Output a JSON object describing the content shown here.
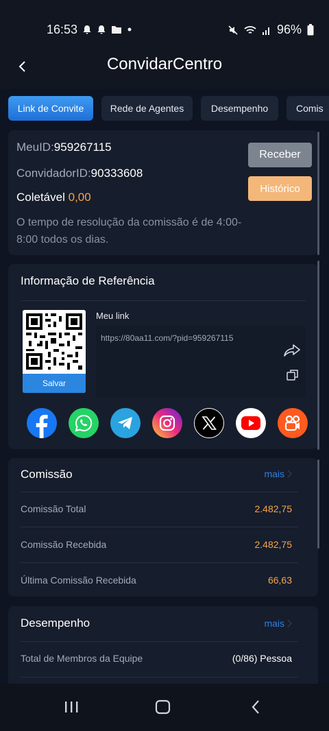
{
  "status_bar": {
    "time": "16:53",
    "battery": "96%"
  },
  "header": {
    "title": "ConvidarCentro"
  },
  "tabs": [
    {
      "label": "Link de Convite",
      "active": true
    },
    {
      "label": "Rede de Agentes",
      "active": false
    },
    {
      "label": "Desempenho",
      "active": false
    },
    {
      "label": "Comis",
      "active": false
    }
  ],
  "account": {
    "my_id_label": "MeuID:",
    "my_id": "959267115",
    "inviter_label": "ConvidadorID:",
    "inviter_id": "90333608",
    "collectable_label": "Coletável",
    "collectable_value": "0,00",
    "receive_button": "Receber",
    "history_button": "Histórico",
    "note": "O tempo de resolução da comissão é de 4:00-8:00 todos os dias."
  },
  "referral": {
    "title": "Informação de Referência",
    "save_button": "Salvar",
    "link_label": "Meu link",
    "url": "https://80aa11.com/?pid=959267115",
    "social": [
      "facebook-icon",
      "whatsapp-icon",
      "telegram-icon",
      "instagram-icon",
      "x-icon",
      "youtube-icon",
      "kwai-icon"
    ]
  },
  "commission": {
    "title": "Comissão",
    "more": "mais",
    "rows": [
      {
        "label": "Comissão Total",
        "value": "2.482,75"
      },
      {
        "label": "Comissão Recebida",
        "value": "2.482,75"
      },
      {
        "label": "Última Comissão Recebida",
        "value": "66,63"
      }
    ]
  },
  "performance": {
    "title": "Desempenho",
    "more": "mais",
    "rows": [
      {
        "label": "Total de Membros da Equipe",
        "value": "(0/86) Pessoa"
      }
    ]
  },
  "colors": {
    "background": "#0e1421",
    "card": "#161d2c",
    "accent_blue": "#2b86e0",
    "accent_orange": "#f7a44a",
    "history_button": "#f4b77a",
    "receive_button": "#7c8490"
  }
}
